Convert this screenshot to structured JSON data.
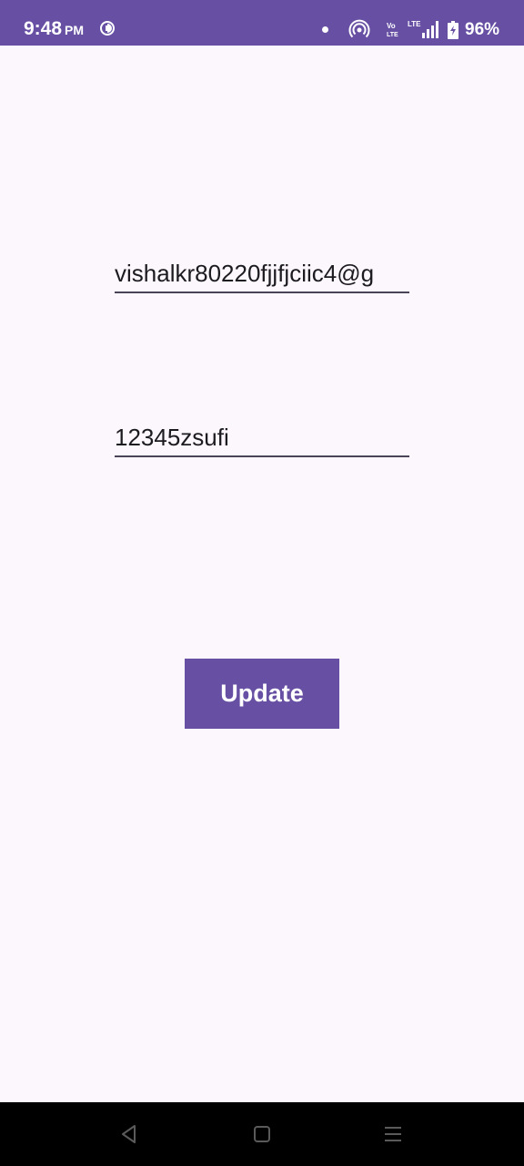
{
  "status_bar": {
    "time": "9:48",
    "ampm": "PM",
    "battery": "96%",
    "icons": [
      "app-notification-icon",
      "dot-icon",
      "hotspot-icon",
      "volte-icon",
      "lte-signal-icon",
      "battery-icon"
    ]
  },
  "form": {
    "email_value": "vishalkr80220fjjfjciic4@g",
    "password_value": "12345zsufi"
  },
  "update_button": {
    "label": "Update"
  },
  "nav_bar": {
    "icons": [
      "back-icon",
      "home-icon",
      "menu-icon"
    ]
  },
  "colors": {
    "accent": "#6750A4",
    "background": "#FCF6FD",
    "text": "#1C1B1F"
  }
}
